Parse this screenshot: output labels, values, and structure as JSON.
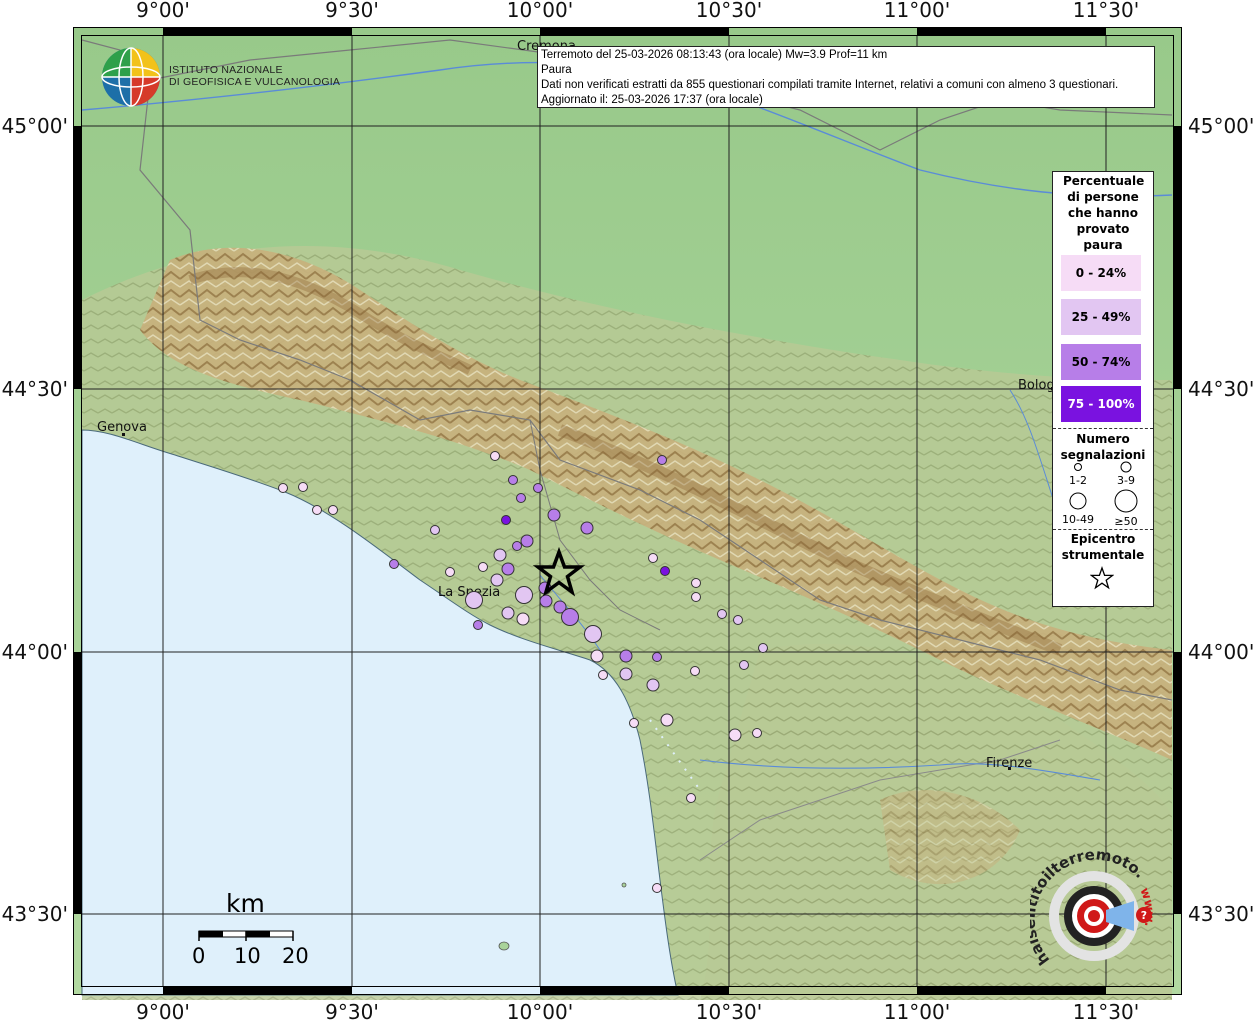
{
  "info": {
    "line1": "Terremoto del 25-03-2026 08:13:43 (ora locale) Mw=3.9 Prof=11 km",
    "line2": "Paura",
    "line3": "Dati non verificati estratti da 855 questionari compilati tramite Internet, relativi a comuni con almeno 3 questionari.",
    "line4": "Aggiornato il: 25-03-2026 17:37 (ora locale)"
  },
  "ingv_logo": {
    "line1": "ISTITUTO NAZIONALE",
    "line2": "DI GEOFISICA E VULCANOLOGIA",
    "icon": "ingv-globe-logo"
  },
  "axes": {
    "lon_labels": [
      "9°00'",
      "9°30'",
      "10°00'",
      "10°30'",
      "11°00'",
      "11°30'"
    ],
    "lat_labels": [
      "45°00'",
      "44°30'",
      "44°00'",
      "43°30'"
    ]
  },
  "cities": [
    {
      "name": "Cremona"
    },
    {
      "name": "Genova"
    },
    {
      "name": "La Spezia"
    },
    {
      "name": "Bologna"
    },
    {
      "name": "Firenze"
    }
  ],
  "legend": {
    "title": "Percentuale di persone che hanno provato paura",
    "classes": [
      {
        "label": "0 - 24%",
        "color": "#f6dcf6"
      },
      {
        "label": "25 - 49%",
        "color": "#e2c6f2"
      },
      {
        "label": "50 - 74%",
        "color": "#b77ee8"
      },
      {
        "label": "75 - 100%",
        "color": "#7a12e0"
      }
    ],
    "count_title": "Numero segnalazioni",
    "counts": [
      "1-2",
      "3-9",
      "10-49",
      "≥50"
    ],
    "epicenter_title": "Epicentro strumentale",
    "epicenter_icon": "star-icon"
  },
  "scale": {
    "unit": "km",
    "labels": [
      "0",
      "10",
      "20"
    ]
  },
  "hsit_logo": {
    "text": "haisentitoilterremoto.it",
    "url_text": "www.",
    "icon": "hsit-target-logo"
  },
  "colors": {
    "sea": "#dff0fb",
    "lowland": "#a9d39a",
    "hills": "#c9b98a",
    "mountains": "#a07844",
    "grid": "#222222"
  }
}
